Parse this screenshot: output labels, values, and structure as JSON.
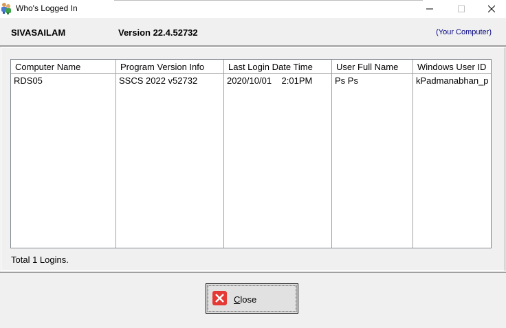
{
  "window": {
    "title": "Who's Logged In",
    "controls": {
      "minimize": "minimize-icon",
      "maximize": "maximize-icon",
      "close": "close-icon"
    }
  },
  "header": {
    "computer_name": "SIVASAILAM",
    "version": "Version 22.4.52732",
    "note": "(Your Computer)"
  },
  "table": {
    "columns": [
      "Computer Name",
      "Program Version Info",
      "Last Login Date Time",
      "User Full Name",
      "Windows User ID"
    ],
    "rows": [
      [
        "RDS05",
        "SSCS 2022 v52732",
        "2020/10/01    2:01PM",
        "Ps Ps",
        "kPadmanabhan_p"
      ]
    ]
  },
  "footer": {
    "total": "Total 1 Logins."
  },
  "buttons": {
    "close_label_underlined": "C",
    "close_label_rest": "lose"
  },
  "colors": {
    "close_icon": "#e53935",
    "note_text": "#000080"
  }
}
